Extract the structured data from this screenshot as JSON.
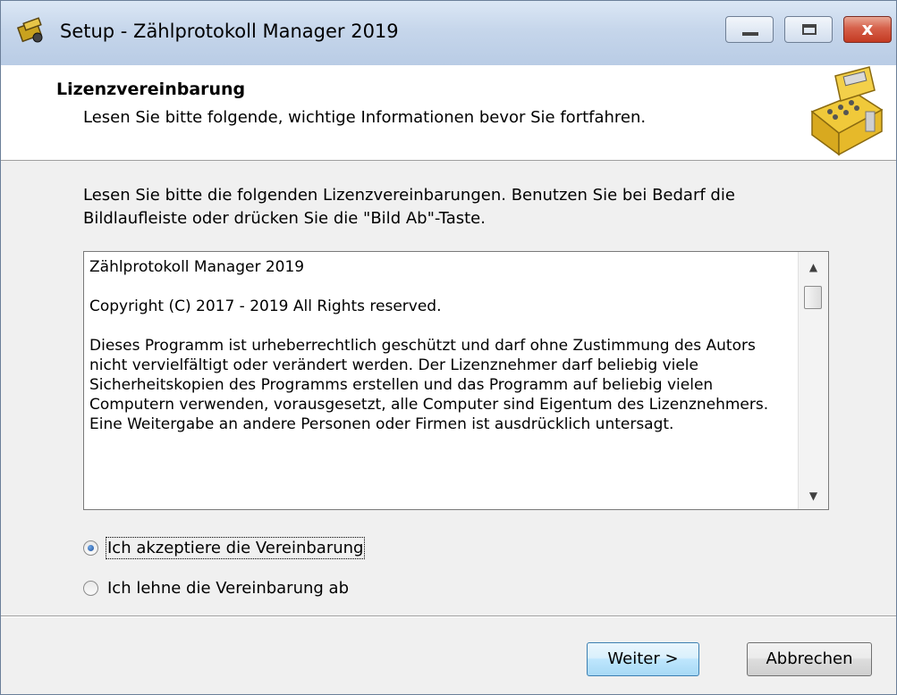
{
  "window": {
    "title": "Setup - Zählprotokoll Manager 2019",
    "controls": {
      "minimize": "minimize",
      "maximize": "maximize",
      "close": "x"
    }
  },
  "header": {
    "title": "Lizenzvereinbarung",
    "subtitle": "Lesen Sie bitte folgende, wichtige Informationen bevor Sie fortfahren.",
    "image_icon": "cash-register-icon"
  },
  "intro": "Lesen Sie bitte die folgenden Lizenzvereinbarungen. Benutzen Sie bei Bedarf die Bildlaufleiste oder drücken Sie die \"Bild Ab\"-Taste.",
  "license": {
    "paragraphs": [
      "Zählprotokoll Manager 2019",
      "Copyright (C) 2017 - 2019 All Rights reserved.",
      "Dieses Programm ist urheberrechtlich geschützt und darf ohne Zustimmung des Autors nicht vervielfältigt oder verändert werden. Der Lizenznehmer darf beliebig viele Sicherheitskopien des Programms erstellen und das Programm auf beliebig vielen Computern verwenden, vorausgesetzt, alle Computer sind Eigentum des Lizenznehmers. Eine Weitergabe an andere Personen oder Firmen ist ausdrücklich untersagt."
    ]
  },
  "options": {
    "accept": "Ich akzeptiere die Vereinbarung",
    "decline": "Ich lehne die Vereinbarung ab",
    "selected": "accept"
  },
  "buttons": {
    "next": "Weiter >",
    "cancel": "Abbrechen"
  }
}
